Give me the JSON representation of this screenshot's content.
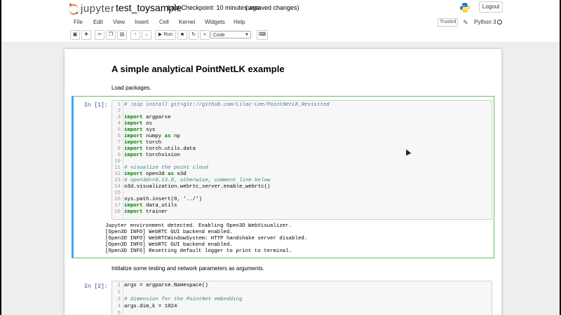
{
  "header": {
    "logo_text": "jupyter",
    "notebook_name": "test_toysample",
    "checkpoint": "Last Checkpoint: 10 minutes ago",
    "unsaved": "(unsaved changes)",
    "logout": "Logout"
  },
  "menu": [
    "File",
    "Edit",
    "View",
    "Insert",
    "Cell",
    "Kernel",
    "Widgets",
    "Help"
  ],
  "kernel": {
    "trusted": "Trusted",
    "name": "Python 3"
  },
  "toolbar": {
    "run_label": "Run",
    "cell_type": "Code",
    "icons": [
      "save-icon",
      "add-cell-icon",
      "cut-icon",
      "copy-icon",
      "paste-icon",
      "move-up-icon",
      "move-down-icon",
      "run-icon",
      "stop-icon",
      "restart-icon",
      "fast-forward-icon",
      "keyboard-icon"
    ]
  },
  "notebook": {
    "heading": "A simple analytical PointNetLK example",
    "md_load": "Load packages.",
    "md_init": "Initialize some testing and network parameters as arguments.",
    "cell1": {
      "prompt": "In [1]:",
      "lines": [
        {
          "n": "1",
          "t": "# !pip install git+git://github.com/Lilac-Lee/PointNetLK_Revisited"
        },
        {
          "n": "2",
          "t": ""
        },
        {
          "n": "3",
          "t": "import argparse"
        },
        {
          "n": "4",
          "t": "import os"
        },
        {
          "n": "5",
          "t": "import sys"
        },
        {
          "n": "6",
          "t": "import numpy as np"
        },
        {
          "n": "7",
          "t": "import torch"
        },
        {
          "n": "8",
          "t": "import torch.utils.data"
        },
        {
          "n": "9",
          "t": "import torchvision"
        },
        {
          "n": "10",
          "t": ""
        },
        {
          "n": "11",
          "t": "# visualize the point cloud"
        },
        {
          "n": "12",
          "t": "import open3d as o3d"
        },
        {
          "n": "13",
          "t": "# open3d>=0.13.0, otherwise, comment line below"
        },
        {
          "n": "14",
          "t": "o3d.visualization.webrtc_server.enable_webrtc()"
        },
        {
          "n": "15",
          "t": ""
        },
        {
          "n": "16",
          "t": "sys.path.insert(0, '../')"
        },
        {
          "n": "17",
          "t": "import data_utils"
        },
        {
          "n": "18",
          "t": "import trainer"
        }
      ],
      "output": [
        "Jupyter environment detected. Enabling Open3D WebVisualizer.",
        "[Open3D INFO] WebRTC GUI backend enabled.",
        "[Open3D INFO] WebRTCWindowSystem: HTTP handshake server disabled.",
        "[Open3D INFO] WebRTC GUI backend enabled.",
        "[Open3D INFO] Resetting default logger to print to terminal."
      ]
    },
    "cell2": {
      "prompt": "In [2]:",
      "lines": [
        {
          "n": "1",
          "t": "args = argparse.Namespace()"
        },
        {
          "n": "2",
          "t": ""
        },
        {
          "n": "3",
          "t": "# dimension for the PointNet embedding"
        },
        {
          "n": "4",
          "t": "args.dim_k = 1024"
        },
        {
          "n": "5",
          "t": ""
        }
      ]
    }
  }
}
